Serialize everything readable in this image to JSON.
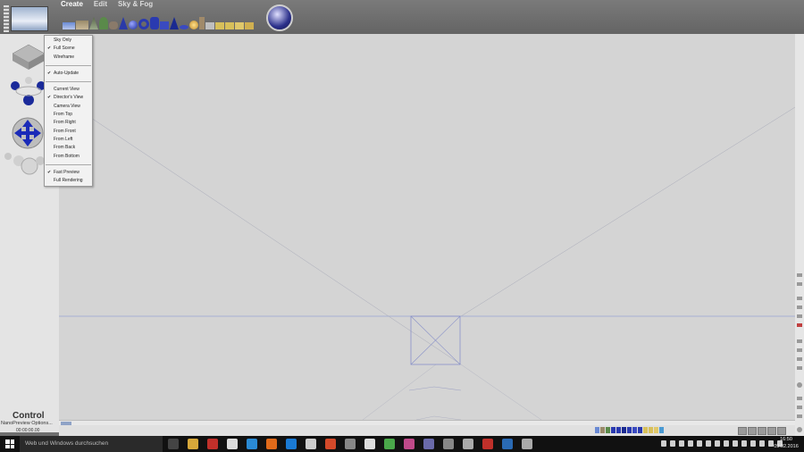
{
  "menu": {
    "create": "Create",
    "edit": "Edit",
    "sky_fog": "Sky & Fog"
  },
  "context_menu": {
    "groups": [
      [
        {
          "label": "Sky Only",
          "checked": false
        },
        {
          "label": "Full Scene",
          "checked": true
        },
        {
          "label": "Wireframe",
          "checked": false
        }
      ],
      [
        {
          "label": "Auto-Update",
          "checked": true
        }
      ],
      [
        {
          "label": "Current View",
          "checked": false
        },
        {
          "label": "Director's View",
          "checked": true
        },
        {
          "label": "Camera View",
          "checked": false
        },
        {
          "label": "From Top",
          "checked": false
        },
        {
          "label": "From Right",
          "checked": false
        },
        {
          "label": "From Front",
          "checked": false
        },
        {
          "label": "From Left",
          "checked": false
        },
        {
          "label": "From Back",
          "checked": false
        },
        {
          "label": "From Bottom",
          "checked": false
        }
      ],
      [
        {
          "label": "Fast Preview",
          "checked": true
        },
        {
          "label": "Full Rendering",
          "checked": false
        }
      ]
    ]
  },
  "control": {
    "title": "Control",
    "nanopreview": "NanoPreview Options...",
    "timecode": "00:00:00.00"
  },
  "taskbar": {
    "search_placeholder": "Web und Windows durchsuchen",
    "time": "16:50",
    "date": "09.02.2016",
    "app_colors": [
      "#444",
      "#d8a83a",
      "#c0302a",
      "#ddd",
      "#2a8ad4",
      "#e06a1a",
      "#1a7ad4",
      "#ccc",
      "#d44a2a",
      "#888",
      "#ddd",
      "#4aa84a",
      "#c04a8a",
      "#6a6aaa",
      "#888",
      "#aaa",
      "#c0302a",
      "#2a6ab4",
      "#aaa"
    ]
  },
  "colors": {
    "viewport_bg": "#d4d4d4",
    "wire": "#8890c8",
    "horizon": "#9aa6d6"
  }
}
